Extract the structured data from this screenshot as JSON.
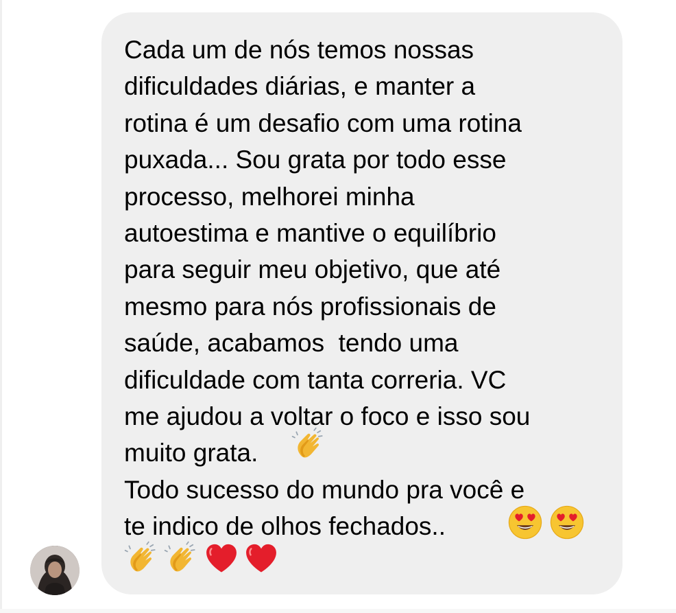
{
  "message": {
    "lines": [
      "Cada um de nós temos nossas",
      "dificuldades diárias, e manter a",
      "rotina é um desafio com uma rotina",
      "puxada... Sou grata por todo esse",
      "processo, melhorei minha",
      "autoestima e mantive o equilíbrio",
      "para seguir meu objetivo, que até",
      "mesmo para nós profissionais de",
      "saúde, acabamos  tendo uma",
      "dificuldade com tanta correria. VC",
      "me ajudou a voltar o foco e isso sou",
      "muito grata.",
      "Todo sucesso do mundo pra você e",
      "te indico de olhos fechados.."
    ],
    "emojis_inline": [
      "clapping-hands",
      "smiling-face-with-heart-eyes",
      "smiling-face-with-heart-eyes"
    ],
    "emojis_last_line": [
      "clapping-hands",
      "clapping-hands",
      "red-heart",
      "red-heart"
    ]
  },
  "colors": {
    "bubble": "#efefef",
    "text": "#000000",
    "heart": "#e41e2b",
    "face": "#f7c531"
  }
}
